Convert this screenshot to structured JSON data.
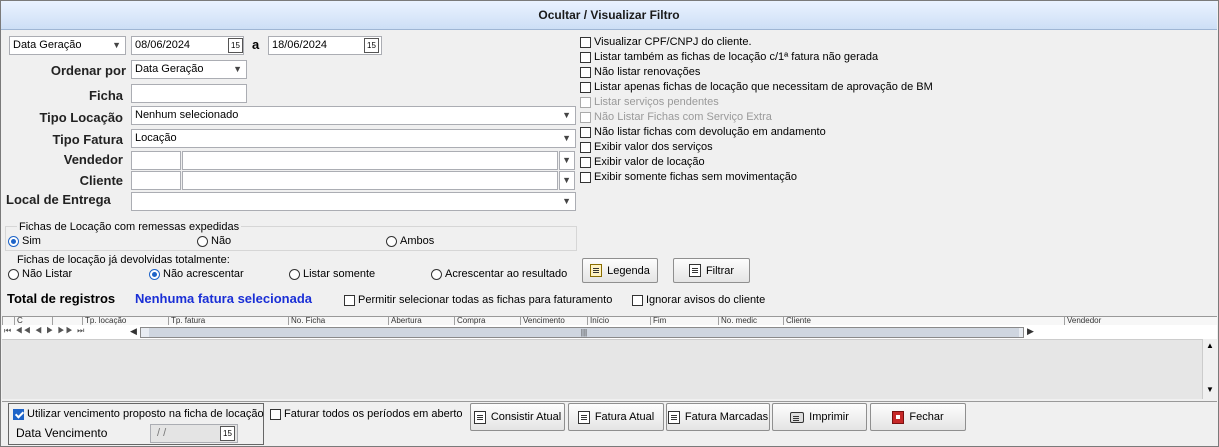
{
  "header": {
    "title": "Ocultar / Visualizar Filtro"
  },
  "filters": {
    "date_type": "Data Geração",
    "date_from": "08/06/2024",
    "date_sep": "a",
    "date_to": "18/06/2024",
    "order_label": "Ordenar por",
    "order_value": "Data Geração",
    "ficha_label": "Ficha",
    "ficha_value": "",
    "tipo_locacao_label": "Tipo Locação",
    "tipo_locacao_value": "Nenhum selecionado",
    "tipo_fatura_label": "Tipo Fatura",
    "tipo_fatura_value": "Locação",
    "vendedor_label": "Vendedor",
    "cliente_label": "Cliente",
    "local_label": "Local de Entrega"
  },
  "options": [
    {
      "label": "Visualizar CPF/CNPJ do cliente.",
      "checked": false,
      "disabled": false
    },
    {
      "label": "Listar também as fichas de locação c/1ª fatura não gerada",
      "checked": false,
      "disabled": false
    },
    {
      "label": "Não listar renovações",
      "checked": false,
      "disabled": false
    },
    {
      "label": "Listar apenas fichas de locação que necessitam de aprovação de BM",
      "checked": false,
      "disabled": false
    },
    {
      "label": "Listar serviços pendentes",
      "checked": false,
      "disabled": true
    },
    {
      "label": "Não Listar Fichas com Serviço Extra",
      "checked": false,
      "disabled": true
    },
    {
      "label": "Não listar fichas com devolução em andamento",
      "checked": false,
      "disabled": false
    },
    {
      "label": "Exibir valor dos serviços",
      "checked": false,
      "disabled": false
    },
    {
      "label": "Exibir valor de locação",
      "checked": false,
      "disabled": false
    },
    {
      "label": "Exibir somente fichas sem movimentação",
      "checked": false,
      "disabled": false
    }
  ],
  "remessas": {
    "title": "Fichas de Locação com remessas expedidas",
    "options": [
      "Sim",
      "Não",
      "Ambos"
    ],
    "selected": "Sim"
  },
  "devolvidas": {
    "title": "Fichas de locação já devolvidas totalmente:",
    "options": [
      "Não Listar",
      "Não acrescentar",
      "Listar somente",
      "Acrescentar ao resultado"
    ],
    "selected": "Não acrescentar"
  },
  "buttons": {
    "legenda": "Legenda",
    "filtrar": "Filtrar"
  },
  "summary": {
    "total_label": "Total de registros",
    "total_value": "Nenhuma fatura selecionada",
    "allow_all": "Permitir selecionar todas as fichas para faturamento",
    "ignore_warnings": "Ignorar avisos do cliente"
  },
  "grid": {
    "columns": [
      "",
      "C",
      "",
      "Tp. locação",
      "Tp. fatura",
      "No. Ficha",
      "Abertura",
      "Compra",
      "Vencimento",
      "Início",
      "Fim",
      "No. medic",
      "Cliente",
      "Vendedor"
    ],
    "nav_glyphs": "⏮ ◀◀ ◀ ▶ ▶▶ ⏭",
    "scroll_grip": "|||"
  },
  "footer": {
    "use_due_label": "Utilizar vencimento proposto na ficha de locação",
    "use_due_checked": true,
    "due_label": "Data Vencimento",
    "due_value": "/ /",
    "bill_all_label": "Faturar todos os períodos em aberto",
    "consistir": "Consistir Atual",
    "fatura_atual": "Fatura Atual",
    "fatura_marcadas": "Fatura Marcadas",
    "imprimir": "Imprimir",
    "fechar": "Fechar"
  },
  "colors": {
    "accent": "#1e64c8",
    "total_value": "#1a2fd6"
  }
}
